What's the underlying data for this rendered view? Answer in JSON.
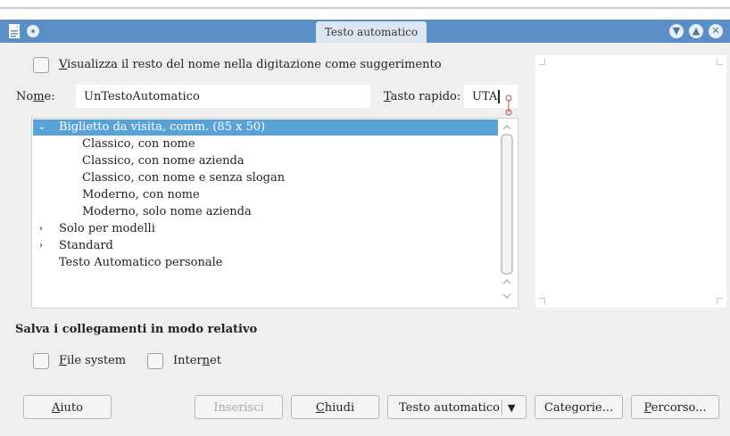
{
  "window": {
    "title": "Testo automatico",
    "controls": [
      "minimize-icon",
      "maximize-icon",
      "close-icon"
    ]
  },
  "options": {
    "show_remainder_label": "Visualizza il resto del nome nella digitazione come suggerimento",
    "show_remainder_mnemonic": "V",
    "show_remainder_rest": "isualizza il resto del nome nella digitazione come suggerimento"
  },
  "name_field": {
    "label_mnemonic": "No",
    "label_underlined": "m",
    "label_rest": "e:",
    "value": "UnTestoAutomatico"
  },
  "shortcut_field": {
    "label_mnemonic": "T",
    "label_rest": "asto rapido:",
    "value": "UTA"
  },
  "tree": {
    "items": [
      {
        "label": "Biglietto da visita, comm. (85 x 50)",
        "level": 0,
        "expanded": true,
        "selected": true
      },
      {
        "label": "Classico, con nome",
        "level": 1
      },
      {
        "label": "Classico, con nome azienda",
        "level": 1
      },
      {
        "label": "Classico, con nome e senza slogan",
        "level": 1
      },
      {
        "label": "Moderno, con nome",
        "level": 1
      },
      {
        "label": "Moderno, solo nome azienda",
        "level": 1
      },
      {
        "label": "Solo per modelli",
        "level": 0,
        "expanded": false
      },
      {
        "label": "Standard",
        "level": 0,
        "expanded": false
      },
      {
        "label": "Testo Automatico personale",
        "level": 0
      }
    ]
  },
  "links_section": {
    "title": "Salva i collegamenti in modo relativo",
    "filesystem_mnemonic": "F",
    "filesystem_rest": "ile system",
    "internet_pre": "Inter",
    "internet_mnemonic": "n",
    "internet_post": "et"
  },
  "buttons": {
    "help_mnemonic": "A",
    "help_rest": "iuto",
    "insert": "Inserisci",
    "close_mnemonic": "C",
    "close_rest": "hiudi",
    "autotext": "Testo automatico",
    "categories_pre": "Cate",
    "categories_mnemonic": "g",
    "categories_post": "orie...",
    "path_mnemonic": "P",
    "path_rest": "ercorso..."
  },
  "colors": {
    "titlebar": "#5b8ec7",
    "selection": "#58a2d8",
    "dialog_bg": "#efefef"
  }
}
